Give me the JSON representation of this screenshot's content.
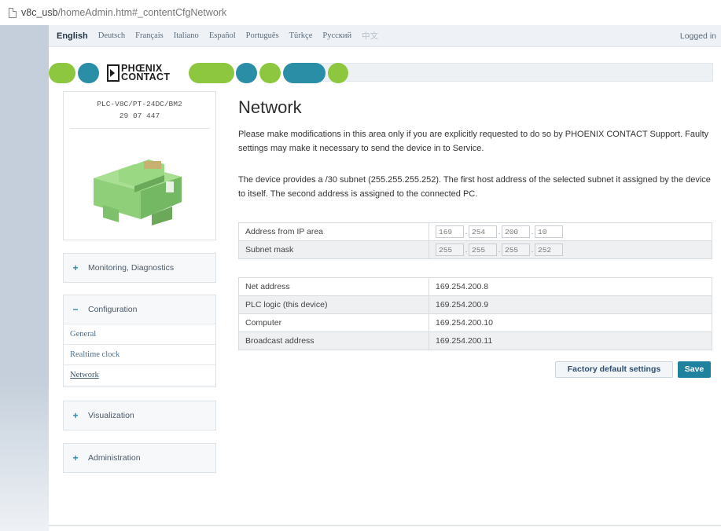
{
  "browser": {
    "url_host": "v8c_usb",
    "url_path": "/homeAdmin.htm#_contentCfgNetwork",
    "page_icon": "document-icon"
  },
  "languages": [
    "English",
    "Deutsch",
    "Français",
    "Italiano",
    "Español",
    "Português",
    "Türkçe",
    "Русский",
    "中文"
  ],
  "active_language": "English",
  "login_status": "Logged in",
  "logo": {
    "line1": "PHŒNIX",
    "line2": "CONTACT"
  },
  "colors": {
    "brand_green": "#8dc63f",
    "brand_teal": "#2b8ea7",
    "save_button": "#20819e"
  },
  "device": {
    "name": "PLC-V8C/PT-24DC/BM2",
    "order_number": "29 07 447"
  },
  "sidebar": {
    "monitoring": {
      "label": "Monitoring, Diagnostics",
      "expander": "+"
    },
    "configuration": {
      "label": "Configuration",
      "expander": "−",
      "items": [
        {
          "label": "General"
        },
        {
          "label": "Realtime clock"
        },
        {
          "label": "Network"
        }
      ]
    },
    "visualization": {
      "label": "Visualization",
      "expander": "+"
    },
    "administration": {
      "label": "Administration",
      "expander": "+"
    }
  },
  "main": {
    "title": "Network",
    "warning": "Please make modifications in this area only if you are explicitly requested to do so by PHOENIX CONTACT Support. Faulty settings may make it necessary to send the device in to Service.",
    "info": "The device provides a /30 subnet (255.255.255.252). The first host address of the selected subnet it assigned by the device to itself. The second address is assigned to the connected PC.",
    "ip_table": {
      "address_label": "Address from IP area",
      "address_octets": [
        "169",
        "254",
        "200",
        "10"
      ],
      "mask_label": "Subnet mask",
      "mask_octets": [
        "255",
        "255",
        "255",
        "252"
      ]
    },
    "info_table": [
      {
        "label": "Net address",
        "value": "169.254.200.8"
      },
      {
        "label": "PLC logic (this device)",
        "value": "169.254.200.9"
      },
      {
        "label": "Computer",
        "value": "169.254.200.10"
      },
      {
        "label": "Broadcast address",
        "value": "169.254.200.11"
      }
    ],
    "factory_button": "Factory default settings",
    "save_button": "Save"
  }
}
